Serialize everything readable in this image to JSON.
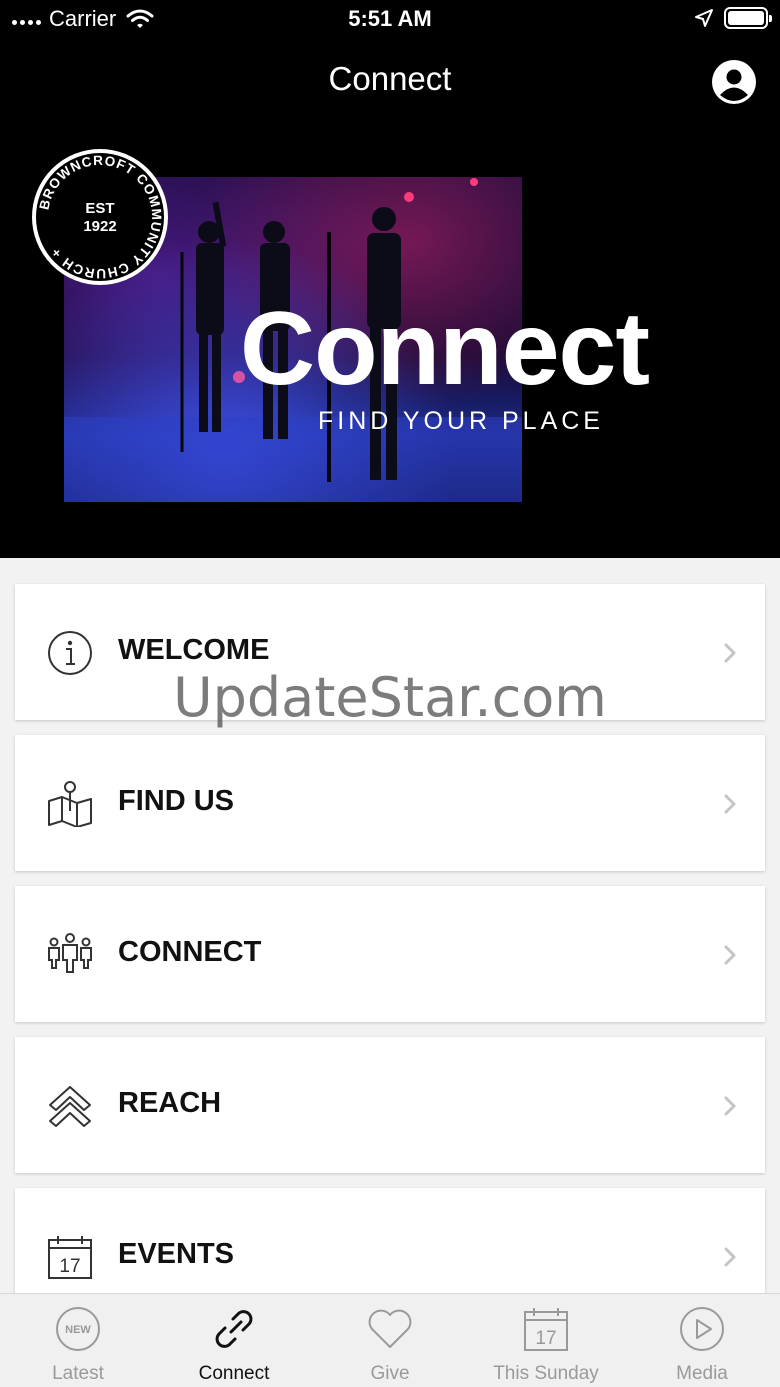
{
  "status_bar": {
    "carrier": "Carrier",
    "time": "5:51 AM"
  },
  "nav": {
    "title": "Connect"
  },
  "hero": {
    "title": "Connect",
    "subtitle": "FIND YOUR PLACE",
    "logo": {
      "top_text": "BROWNCROFT COMMUNITY CHURCH +",
      "est": "EST",
      "year": "1922"
    }
  },
  "menu": {
    "items": [
      {
        "label": "WELCOME",
        "icon": "info-icon"
      },
      {
        "label": "FIND US",
        "icon": "map-pin-icon"
      },
      {
        "label": "CONNECT",
        "icon": "people-icon"
      },
      {
        "label": "REACH",
        "icon": "double-chevron-up-icon"
      },
      {
        "label": "EVENTS",
        "icon": "calendar-icon"
      }
    ]
  },
  "watermark": "UpdateStar.com",
  "tabs": [
    {
      "label": "Latest",
      "icon": "new-badge-icon",
      "badge": "NEW",
      "active": false
    },
    {
      "label": "Connect",
      "icon": "link-icon",
      "active": true
    },
    {
      "label": "Give",
      "icon": "heart-icon",
      "active": false
    },
    {
      "label": "This Sunday",
      "icon": "calendar-icon",
      "day": "17",
      "active": false
    },
    {
      "label": "Media",
      "icon": "play-icon",
      "active": false
    }
  ],
  "colors": {
    "active_tab": "#111111",
    "inactive_tab": "#9a9a9a",
    "header_bg": "#000000"
  }
}
